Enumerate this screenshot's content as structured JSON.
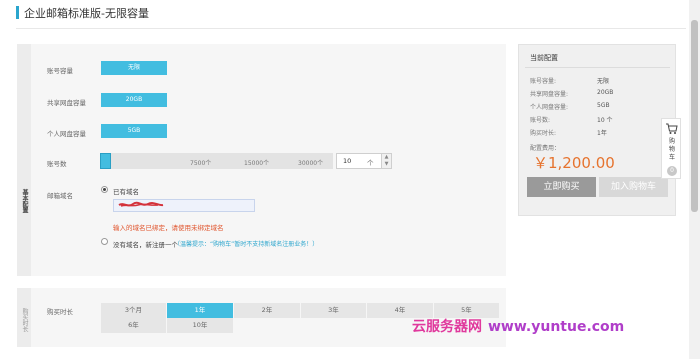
{
  "header": {
    "title": "企业邮箱标准版-无限容量"
  },
  "form": {
    "section_tab": "基本配置",
    "rows": {
      "account_capacity": {
        "label": "账号容量",
        "value": "无限"
      },
      "shared_disk": {
        "label": "共享网盘容量",
        "value": "20GB"
      },
      "personal_disk": {
        "label": "个人网盘容量",
        "value": "5GB"
      }
    },
    "accounts": {
      "label": "账号数",
      "ticks": [
        "7500个",
        "15000个",
        "30000个"
      ],
      "value": "10",
      "unit": "个",
      "stepper_up": "▲",
      "stepper_down": "▼"
    },
    "domain": {
      "label": "邮箱域名",
      "option_have": "已有域名",
      "warning": "输入的域名已绑定，请使用未绑定域名",
      "option_none": "没有域名，新注册一个",
      "hint": "（温馨提示：“购物车”暂时不支持新域名注册业务！）"
    }
  },
  "duration": {
    "section_tab": "购买时长",
    "label": "购买时长",
    "options": [
      "3个月",
      "1年",
      "2年",
      "3年",
      "4年",
      "5年",
      "6年",
      "10年"
    ],
    "selected": "1年"
  },
  "config": {
    "title": "当前配置",
    "items": [
      {
        "key": "账号容量:",
        "value": "无限"
      },
      {
        "key": "共享网盘容量:",
        "value": "20GB"
      },
      {
        "key": "个人网盘容量:",
        "value": "5GB"
      },
      {
        "key": "账号数:",
        "value": "10 个"
      },
      {
        "key": "购买时长:",
        "value": "1年"
      }
    ],
    "price_label": "配置费用：",
    "price": "￥1,200.00",
    "buy_button": "立即购买",
    "cart_button": "加入购物车"
  },
  "cart_float": {
    "label": "购物车",
    "count": "0"
  },
  "watermark": {
    "text1": "云服务器网",
    "text2": "www.yuntue.com"
  },
  "colors": {
    "accent": "#42bde0",
    "price": "#e6732e",
    "warning": "#e0532b"
  }
}
